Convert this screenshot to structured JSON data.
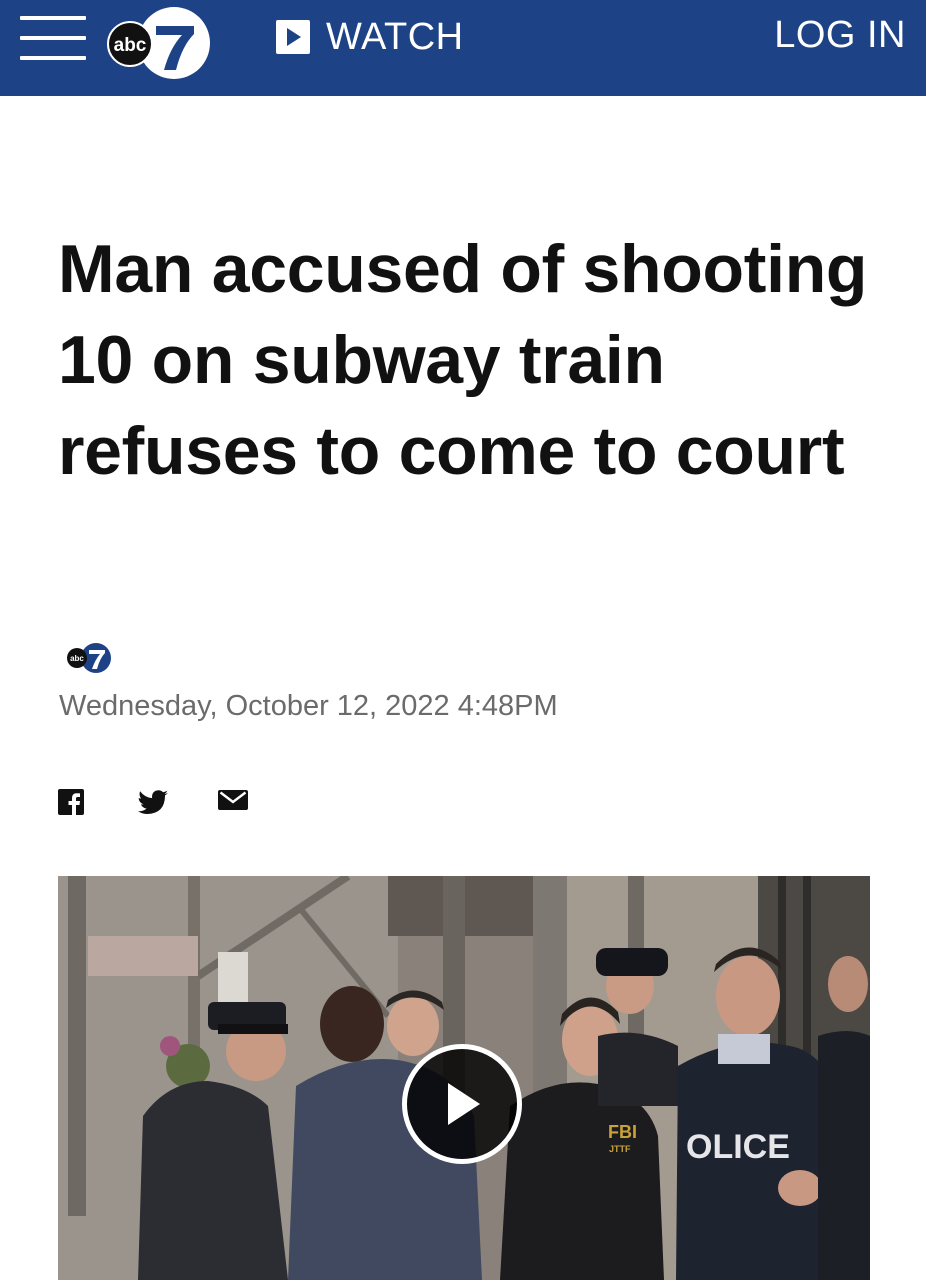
{
  "header": {
    "menu_icon": "hamburger-menu-icon",
    "logo_text": "abc",
    "logo_number": "7",
    "watch_label": "WATCH",
    "watch_icon": "play-square-icon",
    "login_label": "LOG IN",
    "bar_color": "#1d4386"
  },
  "article": {
    "headline": "Man accused of shooting 10 on subway train refuses to come to court",
    "source_logo_text": "abc",
    "source_logo_number": "7",
    "date": "Wednesday, October 12, 2022 4:48PM"
  },
  "share": {
    "icons": [
      "facebook-icon",
      "twitter-icon",
      "email-icon"
    ]
  },
  "video": {
    "play_icon": "play-icon",
    "thumbnail_text": {
      "fbi_patch": "FBI",
      "jttf_patch": "JTTF",
      "police_jacket": "OLICE"
    }
  }
}
